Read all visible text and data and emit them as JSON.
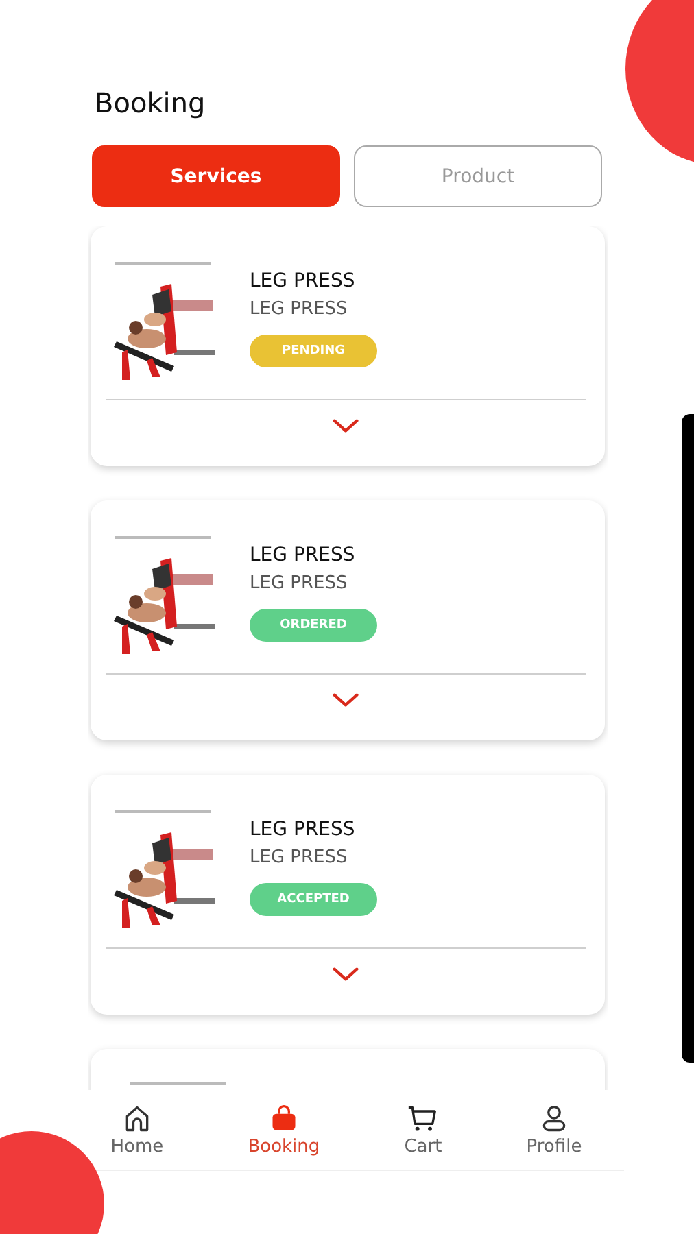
{
  "header": {
    "title": "Booking"
  },
  "tabs": [
    {
      "label": "Services",
      "selected": true
    },
    {
      "label": "Product",
      "selected": false
    }
  ],
  "bookings": [
    {
      "title": "LEG PRESS",
      "subtitle": "LEG PRESS",
      "status": "PENDING",
      "color": "#e9c234"
    },
    {
      "title": "LEG PRESS",
      "subtitle": "LEG PRESS",
      "status": "ORDERED",
      "color": "#5fd08a"
    },
    {
      "title": "LEG PRESS",
      "subtitle": "LEG PRESS",
      "status": "ACCEPTED",
      "color": "#5fd08a"
    }
  ],
  "bottom_nav": [
    {
      "label": "Home",
      "kind": "home",
      "selected": false
    },
    {
      "label": "Booking",
      "kind": "bag",
      "selected": true
    },
    {
      "label": "Cart",
      "kind": "cart",
      "selected": false
    },
    {
      "label": "Profile",
      "kind": "person",
      "selected": false
    }
  ]
}
